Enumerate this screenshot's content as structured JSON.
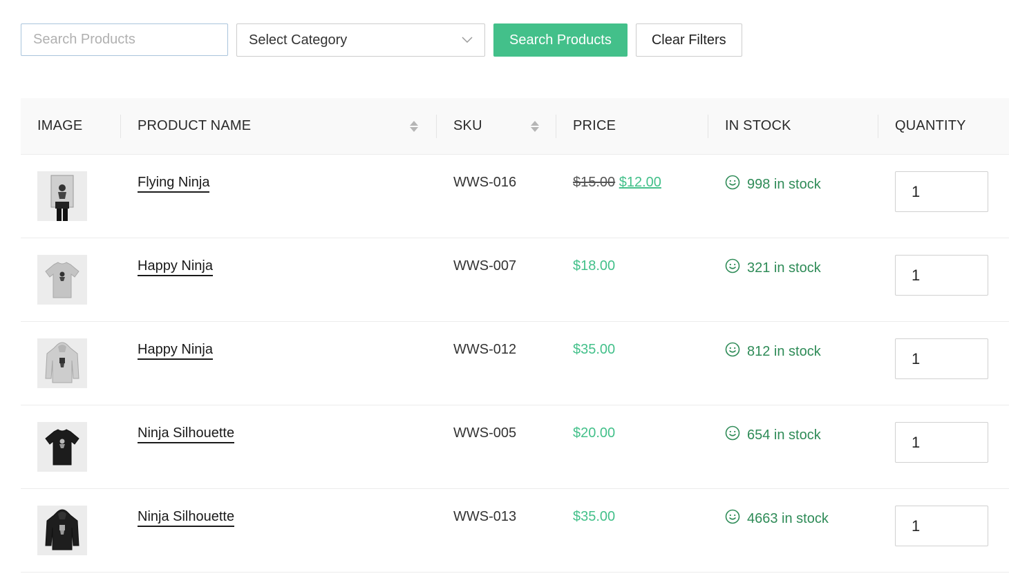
{
  "toolbar": {
    "search_placeholder": "Search Products",
    "category_select": "Select Category",
    "search_button": "Search Products",
    "clear_button": "Clear Filters"
  },
  "table": {
    "headers": {
      "image": "IMAGE",
      "product_name": "PRODUCT NAME",
      "sku": "SKU",
      "price": "PRICE",
      "in_stock": "IN STOCK",
      "quantity": "QUANTITY"
    },
    "rows": [
      {
        "image_icon": "poster-icon",
        "name": "Flying Ninja",
        "sku": "WWS-016",
        "price_old": "$15.00",
        "price": "$12.00",
        "stock": "998 in stock",
        "quantity": "1"
      },
      {
        "image_icon": "tshirt-icon",
        "name": "Happy Ninja",
        "sku": "WWS-007",
        "price": "$18.00",
        "stock": "321 in stock",
        "quantity": "1"
      },
      {
        "image_icon": "hoodie-icon",
        "name": "Happy Ninja",
        "sku": "WWS-012",
        "price": "$35.00",
        "stock": "812 in stock",
        "quantity": "1"
      },
      {
        "image_icon": "tshirt-icon",
        "name": "Ninja Silhouette",
        "sku": "WWS-005",
        "price": "$20.00",
        "stock": "654 in stock",
        "quantity": "1"
      },
      {
        "image_icon": "hoodie-icon",
        "name": "Ninja Silhouette",
        "sku": "WWS-013",
        "price": "$35.00",
        "stock": "4663 in stock",
        "quantity": "1"
      }
    ]
  },
  "colors": {
    "accent": "#43c08a",
    "stock_text": "#2e8b57",
    "header_bg": "#f9f9f9"
  }
}
